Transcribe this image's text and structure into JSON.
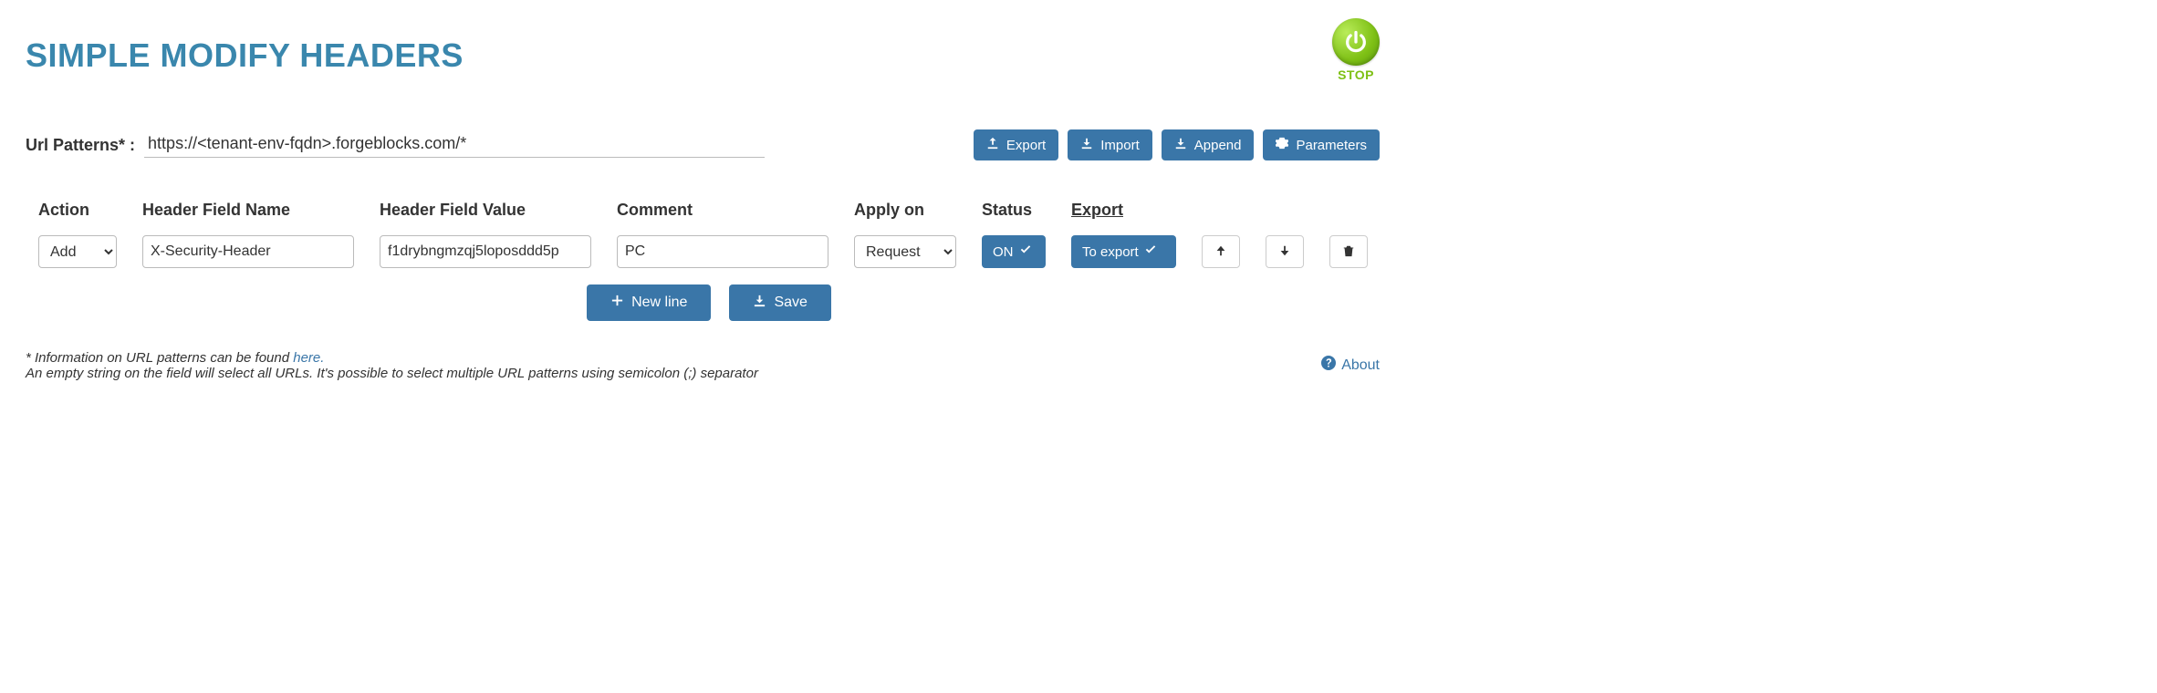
{
  "title": "SIMPLE MODIFY HEADERS",
  "stop": {
    "label": "STOP"
  },
  "url_patterns": {
    "label": "Url Patterns* :",
    "value": "https://<tenant-env-fqdn>.forgeblocks.com/*"
  },
  "toolbar": {
    "export": "Export",
    "import": "Import",
    "append": "Append",
    "parameters": "Parameters"
  },
  "headers": {
    "action": "Action",
    "field_name": "Header Field Name",
    "field_value": "Header Field Value",
    "comment": "Comment",
    "apply_on": "Apply on",
    "status": "Status",
    "export": "Export"
  },
  "row": {
    "action_selected": "Add",
    "action_options": [
      "Add"
    ],
    "field_name": "X-Security-Header",
    "field_value": "f1drybngmzqj5loposddd5p",
    "comment": "PC",
    "apply_on_selected": "Request",
    "apply_on_options": [
      "Request"
    ],
    "status_label": "ON",
    "export_label": "To export"
  },
  "actions": {
    "new_line": "New line",
    "save": "Save"
  },
  "footer": {
    "line1_prefix": "* Information on URL patterns can be found ",
    "line1_link": "here.",
    "line2": "An empty string on the field will select all URLs. It's possible to select multiple URL patterns using semicolon (;) separator",
    "about": "About"
  }
}
